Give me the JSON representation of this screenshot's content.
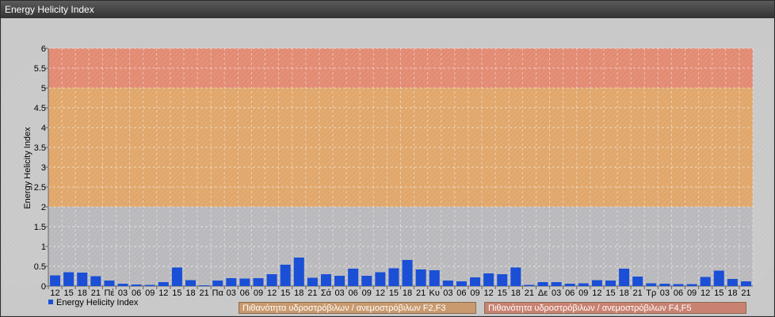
{
  "window": {
    "title": "Energy Helicity Index"
  },
  "legend": {
    "series_label": "Energy Helicity Index",
    "band_f2f3": "Πιθανότητα υδροστρόβιλων / ανεμοστρόβιλων F2,F3",
    "band_f4f5": "Πιθανότητα υδροστρόβιλων / ανεμοστρόβιλων F4,F5"
  },
  "colors": {
    "bar": "#1a4fd6",
    "band_low": "#b9b9bd",
    "band_mid": "#e0a66a",
    "band_high": "#e28a72",
    "legend_f2f3": "#c99a6e",
    "legend_f4f5": "#c98272"
  },
  "chart_data": {
    "type": "bar",
    "ylabel": "Energy Helicity Index",
    "ylim": [
      0,
      6
    ],
    "yticks": [
      "0",
      "0.5",
      "1",
      "1.5",
      "2",
      "2.5",
      "3",
      "3.5",
      "4",
      "4.5",
      "5",
      "5.5",
      "6"
    ],
    "bands": [
      {
        "from": 0,
        "to": 2,
        "color": "#b9b9bd"
      },
      {
        "from": 2,
        "to": 5,
        "color": "#e0a66a"
      },
      {
        "from": 5,
        "to": 6,
        "color": "#e28a72"
      }
    ],
    "categories": [
      "12",
      "15",
      "18",
      "21",
      "Πέ",
      "03",
      "06",
      "09",
      "12",
      "15",
      "18",
      "21",
      "Πα",
      "03",
      "06",
      "09",
      "12",
      "15",
      "18",
      "21",
      "Σά",
      "03",
      "06",
      "09",
      "12",
      "15",
      "18",
      "21",
      "Κυ",
      "03",
      "06",
      "09",
      "12",
      "15",
      "18",
      "21",
      "Δε",
      "03",
      "06",
      "09",
      "12",
      "15",
      "18",
      "21",
      "Τρ",
      "03",
      "06",
      "09",
      "12",
      "15",
      "18",
      "21"
    ],
    "series": [
      {
        "name": "Energy Helicity Index",
        "values": [
          0.27,
          0.35,
          0.34,
          0.25,
          0.14,
          0.06,
          0.04,
          0.03,
          0.1,
          0.47,
          0.15,
          0.02,
          0.14,
          0.2,
          0.19,
          0.2,
          0.3,
          0.54,
          0.72,
          0.21,
          0.3,
          0.26,
          0.44,
          0.26,
          0.35,
          0.45,
          0.66,
          0.42,
          0.4,
          0.14,
          0.12,
          0.22,
          0.32,
          0.3,
          0.47,
          0.03,
          0.1,
          0.1,
          0.06,
          0.07,
          0.15,
          0.14,
          0.44,
          0.24,
          0.07,
          0.06,
          0.05,
          0.05,
          0.23,
          0.39,
          0.18,
          0.12
        ]
      }
    ],
    "grid": true
  }
}
